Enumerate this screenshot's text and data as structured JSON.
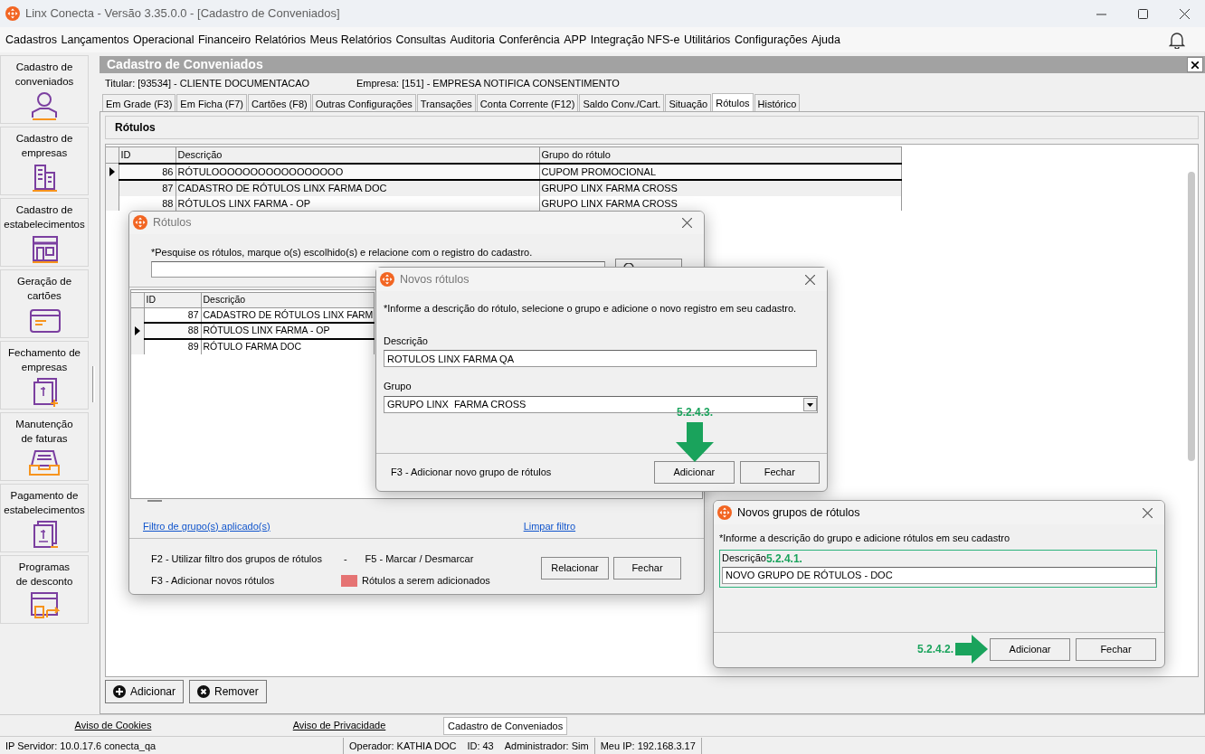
{
  "window": {
    "title": "Linx Conecta - Versão 3.35.0.0 - [Cadastro de Conveniados]"
  },
  "menu": [
    "Cadastros",
    "Lançamentos",
    "Operacional",
    "Financeiro",
    "Relatórios",
    "Meus Relatórios",
    "Consultas",
    "Auditoria",
    "Conferência",
    "APP",
    "Integração NFS-e",
    "Utilitários",
    "Configurações",
    "Ajuda"
  ],
  "sidebar": {
    "items": [
      {
        "label": "Cadastro de\nconveniados",
        "kind": "person"
      },
      {
        "label": "Cadastro de\nempresas",
        "kind": "building"
      },
      {
        "label": "Cadastro de\nestabelecimentos",
        "kind": "store"
      },
      {
        "label": "Geração de\ncartões",
        "kind": "card"
      },
      {
        "label": "Fechamento de\nempresas",
        "kind": "invoice-plus"
      },
      {
        "label": "Manutenção\nde faturas",
        "kind": "tray"
      },
      {
        "label": "Pagamento de\nestabelecimentos",
        "kind": "invoice-minus"
      },
      {
        "label": "Programas\nde desconto",
        "kind": "window-arrow"
      }
    ]
  },
  "form": {
    "title": "Cadastro de Conveniados",
    "titular": "Titular: [93534] - CLIENTE DOCUMENTACAO",
    "empresa": "Empresa: [151] - EMPRESA NOTIFICA CONSENTIMENTO"
  },
  "tabs": [
    {
      "label": "Em Grade (F3)",
      "selected": false
    },
    {
      "label": "Em Ficha (F7)",
      "selected": false
    },
    {
      "label": "Cartões (F8)",
      "selected": false
    },
    {
      "label": "Outras Configurações",
      "selected": false
    },
    {
      "label": "Transações",
      "selected": false
    },
    {
      "label": "Conta Corrente (F12)",
      "selected": false
    },
    {
      "label": "Saldo Conv./Cart.",
      "selected": false
    },
    {
      "label": "Situação",
      "selected": false
    },
    {
      "label": "Rótulos",
      "selected": true
    },
    {
      "label": "Histórico",
      "selected": false
    }
  ],
  "panel": {
    "title": "Rótulos",
    "table": {
      "columns": [
        "ID",
        "Descrição",
        "Grupo do rótulo"
      ],
      "rows": [
        {
          "id": "86",
          "descricao": "RÓTULOOOOOOOOOOOOOOOOO",
          "grupo": "CUPOM PROMOCIONAL",
          "selected": true
        },
        {
          "id": "87",
          "descricao": "CADASTRO DE RÓTULOS LINX FARMA DOC",
          "grupo": "GRUPO LINX  FARMA CROSS",
          "selected": false
        },
        {
          "id": "88",
          "descricao": "RÓTULOS LINX FARMA - OP",
          "grupo": "GRUPO LINX  FARMA CROSS",
          "selected": false
        }
      ]
    },
    "buttons": [
      {
        "label": "Adicionar",
        "kind": "add"
      },
      {
        "label": "Remover",
        "kind": "remove"
      }
    ]
  },
  "rotulos_dialog": {
    "title": "Rótulos",
    "active": false,
    "instruction": "*Pesquise os rótulos, marque o(s) escolhido(s) e relacione com o registro do cadastro.",
    "table": {
      "columns": [
        "ID",
        "Descrição"
      ],
      "rows": [
        {
          "id": "87",
          "descricao": "CADASTRO DE RÓTULOS LINX FARM",
          "selected": false
        },
        {
          "id": "88",
          "descricao": "RÓTULOS LINX FARMA - OP",
          "selected": true
        },
        {
          "id": "89",
          "descricao": "RÓTULO FARMA DOC",
          "selected": false
        }
      ]
    },
    "links": [
      "Filtro de grupo(s) aplicado(s)",
      "Limpar filtro"
    ],
    "legend": [
      "F2 - Utilizar filtro dos grupos de rótulos",
      "-",
      "F5 - Marcar / Desmarcar",
      "F3 - Adicionar novos rótulos"
    ],
    "swatch": {
      "label": "Rótulos a serem adicionados",
      "color": "#e57373"
    },
    "buttons": [
      "Relacionar",
      "Fechar"
    ]
  },
  "novos_rotulos_dialog": {
    "title": "Novos rótulos",
    "active": false,
    "instruction": "*Informe a descrição do rótulo, selecione o grupo e adicione o novo registro em seu cadastro.",
    "fields": [
      {
        "label": "Descrição",
        "value": "ROTULOS LINX FARMA QA",
        "kind": "text"
      },
      {
        "label": "Grupo",
        "value": "GRUPO LINX  FARMA CROSS",
        "kind": "select"
      }
    ],
    "annotation": "5.2.4.3.",
    "hint": "F3 - Adicionar novo grupo de rótulos",
    "buttons": [
      "Adicionar",
      "Fechar"
    ]
  },
  "novos_grupos_dialog": {
    "title": "Novos grupos de rótulos",
    "active": true,
    "instruction": "*Informe a descrição do grupo e adicione rótulos em seu cadastro",
    "field": {
      "label": "Descrição",
      "value": "NOVO GRUPO DE RÓTULOS - DOC"
    },
    "field_annotation": "5.2.4.1.",
    "button_annotation": "5.2.4.2.",
    "buttons": [
      "Adicionar",
      "Fechar"
    ]
  },
  "footer_tabs": [
    {
      "label": "Aviso de Cookies",
      "selected": false
    },
    {
      "label": "Aviso de Privacidade",
      "selected": false
    },
    {
      "label": "Cadastro de Conveniados",
      "selected": true
    }
  ],
  "status_bar": [
    "IP Servidor: 10.0.17.6 conecta_qa",
    "Operador: KATHIA DOC",
    "ID: 43",
    "Administrador: Sim",
    "Meu IP: 192.168.3.17"
  ]
}
